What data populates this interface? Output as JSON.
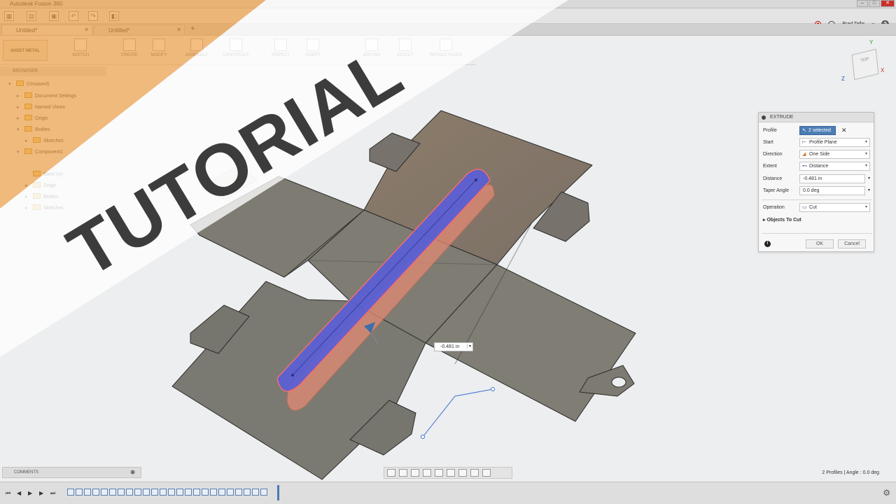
{
  "app_title": "Autodesk Fusion 360",
  "user": {
    "name": "Brad Tallis"
  },
  "tabs": [
    {
      "label": "Untitled*"
    },
    {
      "label": "Untitled*"
    }
  ],
  "workspace": "SHEET METAL",
  "toolbar": [
    "SKETCH",
    "CREATE",
    "MODIFY",
    "ASSEMBLE",
    "CONSTRUCT",
    "INSPECT",
    "INSERT",
    "ADD-INS",
    "SELECT",
    "REFOLD FACES"
  ],
  "browser": {
    "title": "BROWSER",
    "items": [
      "(Unsaved)",
      "Document Settings",
      "Named Views",
      "Origin",
      "Bodies",
      "Sketches",
      "Component1",
      "Steel (in)",
      "Origin",
      "Bodies",
      "Sketches"
    ]
  },
  "overlay_text": "TUTORIAL",
  "viewcube": {
    "face": "TOP",
    "axes": {
      "x": "X",
      "y": "Y",
      "z": "Z"
    }
  },
  "extrude_panel": {
    "title": "EXTRUDE",
    "profile": {
      "label": "Profile",
      "value": "2 selected",
      "clear": "✕"
    },
    "start": {
      "label": "Start",
      "value": "Profile Plane"
    },
    "direction": {
      "label": "Direction",
      "value": "One Side"
    },
    "extent": {
      "label": "Extent",
      "value": "Distance"
    },
    "distance": {
      "label": "Distance",
      "value": "-0.481 in"
    },
    "taper": {
      "label": "Taper Angle",
      "value": "0.0 deg"
    },
    "operation": {
      "label": "Operation",
      "value": "Cut"
    },
    "objects_to_cut": "Objects To Cut",
    "ok": "OK",
    "cancel": "Cancel"
  },
  "float_distance": "-0.481 in",
  "comments": "COMMENTS",
  "status": "2 Profiles | Angle : 0.0 deg",
  "colors": {
    "accent": "#4d7db5",
    "overlay": "#f19a36",
    "cut_blue": "#5a5fd6",
    "cut_red": "#e38a73",
    "sheet": "#7a7870"
  }
}
